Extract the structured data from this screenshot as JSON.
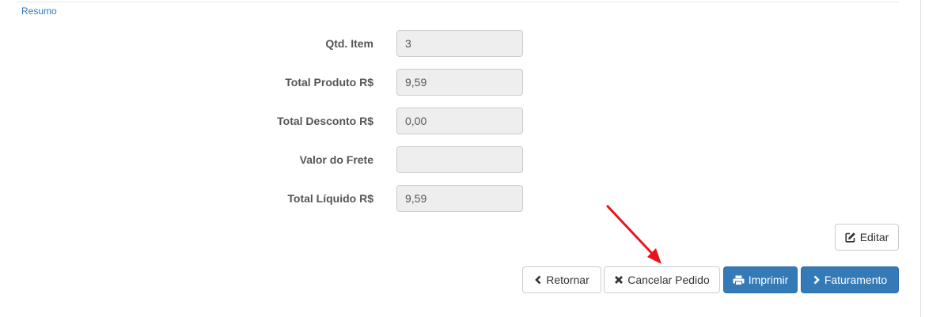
{
  "section": {
    "link_label": "Resumo"
  },
  "summary": {
    "fields": [
      {
        "label": "Qtd. Item",
        "value": "3"
      },
      {
        "label": "Total Produto R$",
        "value": "9,59"
      },
      {
        "label": "Total Desconto R$",
        "value": "0,00"
      },
      {
        "label": "Valor do Frete",
        "value": ""
      },
      {
        "label": "Total Líquido R$",
        "value": "9,59"
      }
    ]
  },
  "actions": {
    "edit_label": "Editar",
    "back_label": "Retornar",
    "cancel_order_label": "Cancelar Pedido",
    "print_label": "Imprimir",
    "billing_label": "Faturamento"
  },
  "icons": {
    "edit": "edit-icon",
    "back": "chevron-left-icon",
    "cancel": "close-icon",
    "print": "print-icon",
    "billing": "chevron-right-icon"
  },
  "colors": {
    "primary": "#337ab7",
    "link": "#337ab7",
    "annotation": "#e8141b"
  }
}
